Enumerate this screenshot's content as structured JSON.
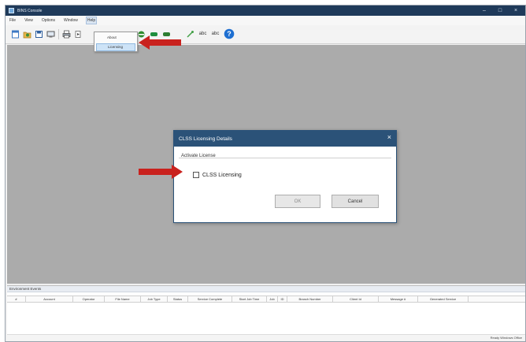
{
  "app": {
    "title": "BINS Console",
    "window_controls": [
      "minimize",
      "maximize",
      "close"
    ]
  },
  "menubar": {
    "items": [
      {
        "label": "File",
        "open": false
      },
      {
        "label": "View",
        "open": false
      },
      {
        "label": "Options",
        "open": false
      },
      {
        "label": "Window",
        "open": false
      },
      {
        "label": "Help",
        "open": true
      }
    ]
  },
  "help_menu": {
    "items": [
      {
        "label": "About",
        "active": false
      },
      {
        "label": "Licensing",
        "active": true
      }
    ]
  },
  "toolbar": {
    "icons": [
      "new-icon",
      "open-icon",
      "save-icon",
      "connect-icon",
      "print-icon",
      "run-icon",
      "stop-icon",
      "refresh-icon",
      "link-icon",
      "text-icon",
      "text-small-icon",
      "help-icon"
    ]
  },
  "dialog": {
    "title": "CLSS Licensing Details",
    "close_label": "×",
    "group_label": "Activate License",
    "checkbox_label": "CLSS Licensing",
    "checkbox_checked": false,
    "ok_label": "OK",
    "ok_enabled": false,
    "cancel_label": "Cancel"
  },
  "bottom_panel": {
    "header": "Environment Events",
    "columns": [
      "#",
      "Account",
      "Operator",
      "File Name",
      "Job Type",
      "Status",
      "Service Complete",
      "Start Job Time",
      "Job",
      "ID",
      "Branch Number",
      "Client Id",
      "Message #",
      "Generated Service"
    ]
  },
  "status": {
    "text": "Ready Windows Office"
  },
  "colors": {
    "titlebar": "#1f3a5a",
    "dialog_titlebar": "#2b5278",
    "workspace": "#ababab",
    "annotation_arrow": "#c9221e"
  }
}
